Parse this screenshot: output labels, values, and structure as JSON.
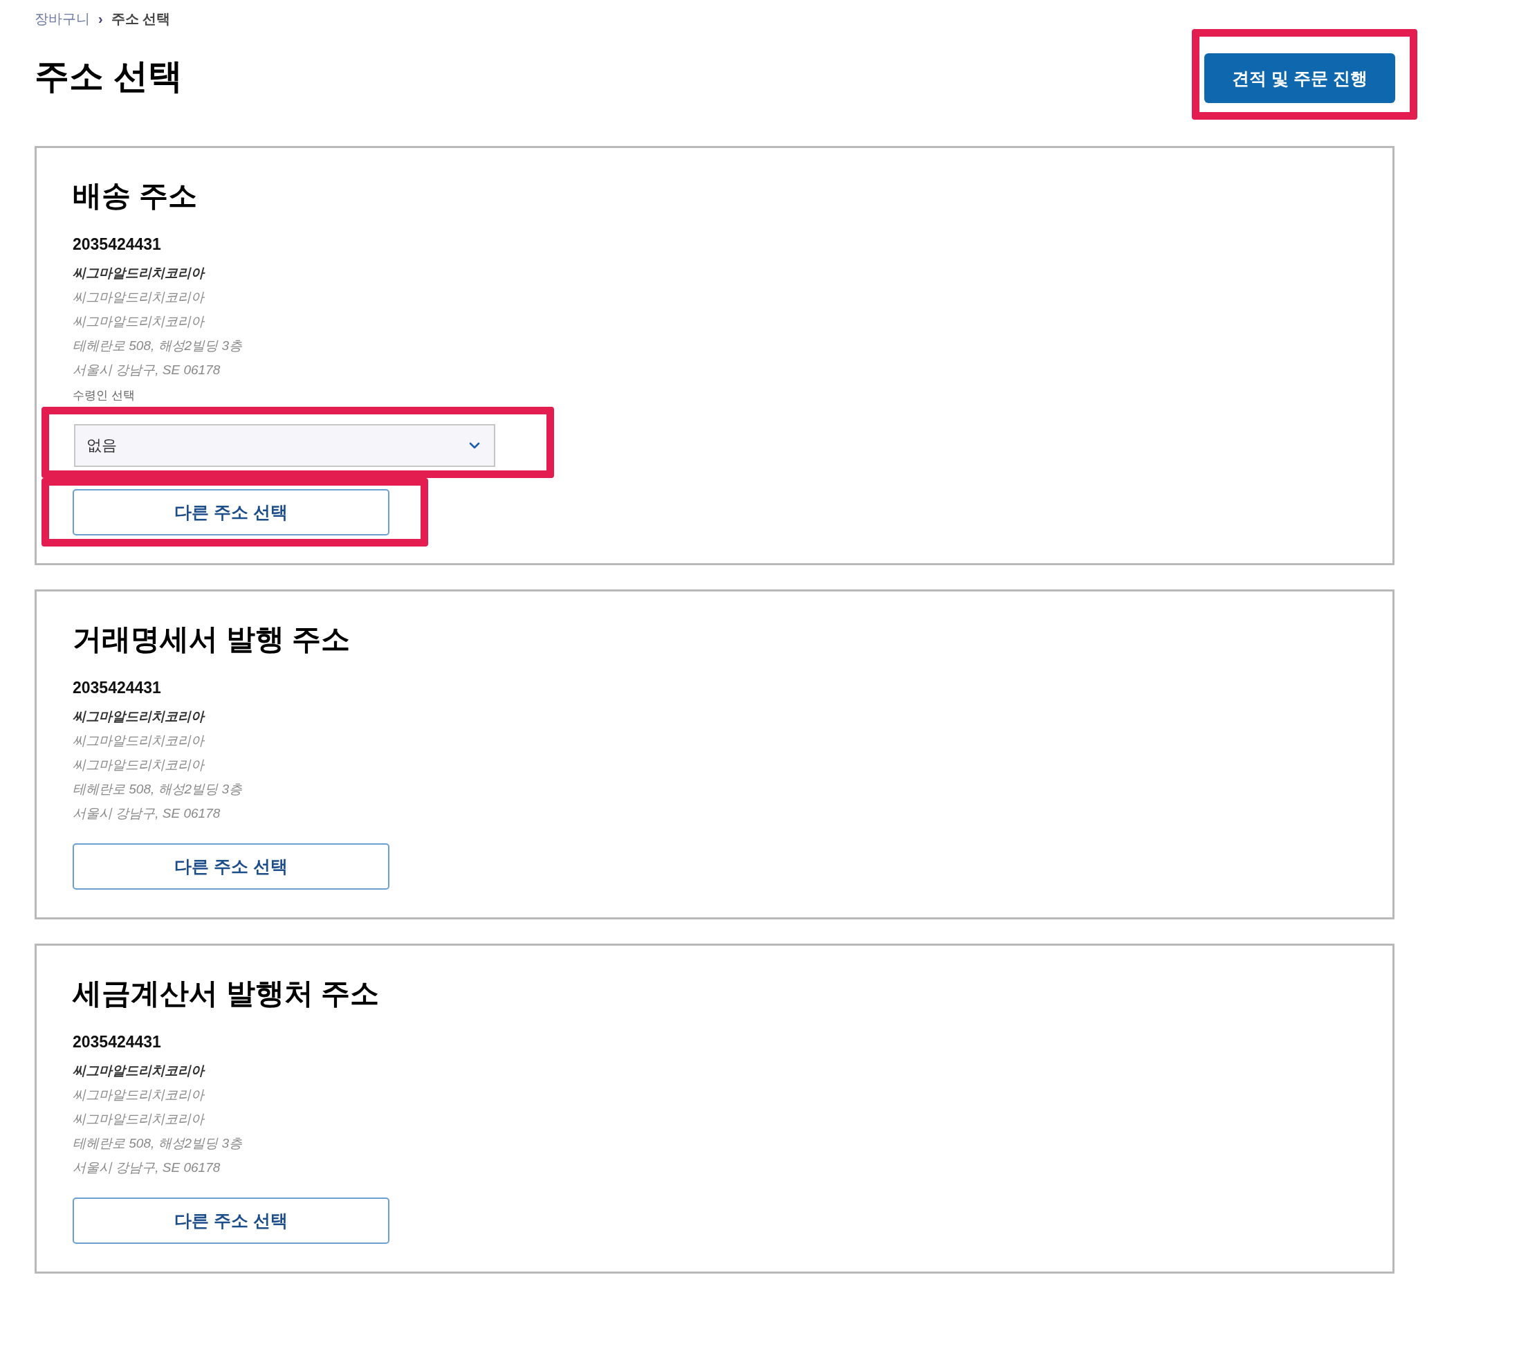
{
  "breadcrumb": {
    "items": [
      {
        "label": "장바구니",
        "kind": "link"
      },
      {
        "label": "주소 선택",
        "kind": "current"
      }
    ],
    "separator": "›"
  },
  "title": "주소 선택",
  "proceed_button": {
    "label": "견적 및 주문 진행",
    "highlighted": true
  },
  "sections": [
    {
      "title": "배송 주소",
      "account_number": "2035424431",
      "company": "씨그마알드리치코리아",
      "lines": [
        "씨그마알드리치코리아",
        "씨그마알드리치코리아",
        "테헤란로 508, 해성2빌딩 3층",
        "서울시 강남구, SE 06178"
      ],
      "recipient_select": {
        "label": "수령인 선택",
        "value": "없음",
        "highlighted": true
      },
      "change_button": {
        "label": "다른 주소 선택",
        "highlighted": true
      }
    },
    {
      "title": "거래명세서 발행 주소",
      "account_number": "2035424431",
      "company": "씨그마알드리치코리아",
      "lines": [
        "씨그마알드리치코리아",
        "씨그마알드리치코리아",
        "테헤란로 508, 해성2빌딩 3층",
        "서울시 강남구, SE 06178"
      ],
      "change_button": {
        "label": "다른 주소 선택",
        "highlighted": false
      }
    },
    {
      "title": "세금계산서 발행처 주소",
      "account_number": "2035424431",
      "company": "씨그마알드리치코리아",
      "lines": [
        "씨그마알드리치코리아",
        "씨그마알드리치코리아",
        "테헤란로 508, 해성2빌딩 3층",
        "서울시 강남구, SE 06178"
      ],
      "change_button": {
        "label": "다른 주소 선택",
        "highlighted": false
      }
    }
  ]
}
